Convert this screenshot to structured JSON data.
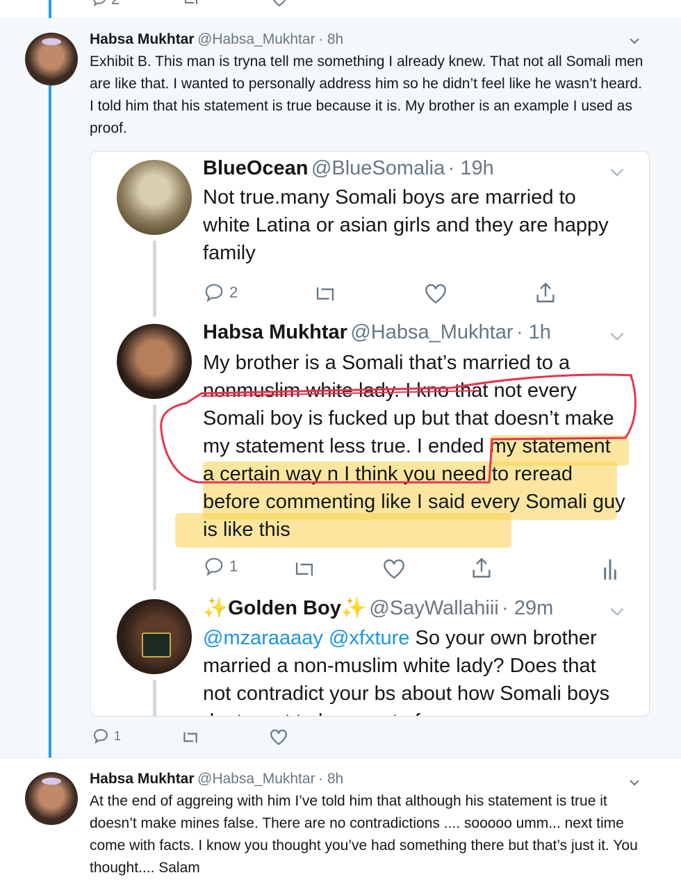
{
  "top_actions": {
    "reply_count": "2"
  },
  "tweet1": {
    "name": "Habsa Mukhtar",
    "handle": "@Habsa_Mukhtar",
    "time": "· 8h",
    "text": "Exhibit B. This man is tryna tell me something I already knew. That not all Somali men are like that. I wanted to personally address him so he didn’t feel like he wasn’t heard. I told him that his statement is true because it is. My brother is an example I used as proof.",
    "reply_count": "1"
  },
  "embed": {
    "t1": {
      "name": "BlueOcean",
      "handle": "@BlueSomalia",
      "time": "· 19h",
      "text": "Not true.many Somali boys are married to white Latina or asian girls and they are happy family",
      "reply_count": "2"
    },
    "t2": {
      "name": "Habsa Mukhtar",
      "handle": "@Habsa_Mukhtar",
      "time": "· 1h",
      "text": "My brother is a Somali that’s married to a nonmuslim white lady. I kno that not every Somali boy is fucked up but that doesn’t make my statement less true. I ended my statement a certain way n I think you need to reread before commenting like I said every Somali guy is like this",
      "reply_count": "1"
    },
    "t3": {
      "name": "✨Golden Boy✨",
      "handle": "@SayWallahiii",
      "time": "· 29m",
      "mention1": "@mzaraaaay",
      "mention2": "@xfxture",
      "text": "So your own brother married a non-muslim white lady? Does that not contradict your bs about how Somali boys dont want to be a part of"
    }
  },
  "tweet2": {
    "name": "Habsa Mukhtar",
    "handle": "@Habsa_Mukhtar",
    "time": "· 8h",
    "text": "At the end of aggreing with him I’ve told him that although his statement is true it doesn’t make mines false. There are no contradictions .... sooooo umm... next time come with facts. I know you thought you’ve had something there but that’s just it. You thought.... Salam"
  },
  "colors": {
    "accent": "#1da1f2",
    "highlight": "#fad250",
    "annotation_red": "#e8344e",
    "thread_bg": "#f5f8fa"
  },
  "icons": [
    "reply-icon",
    "retweet-icon",
    "like-icon",
    "share-icon",
    "analytics-icon",
    "chevron-down-icon"
  ]
}
